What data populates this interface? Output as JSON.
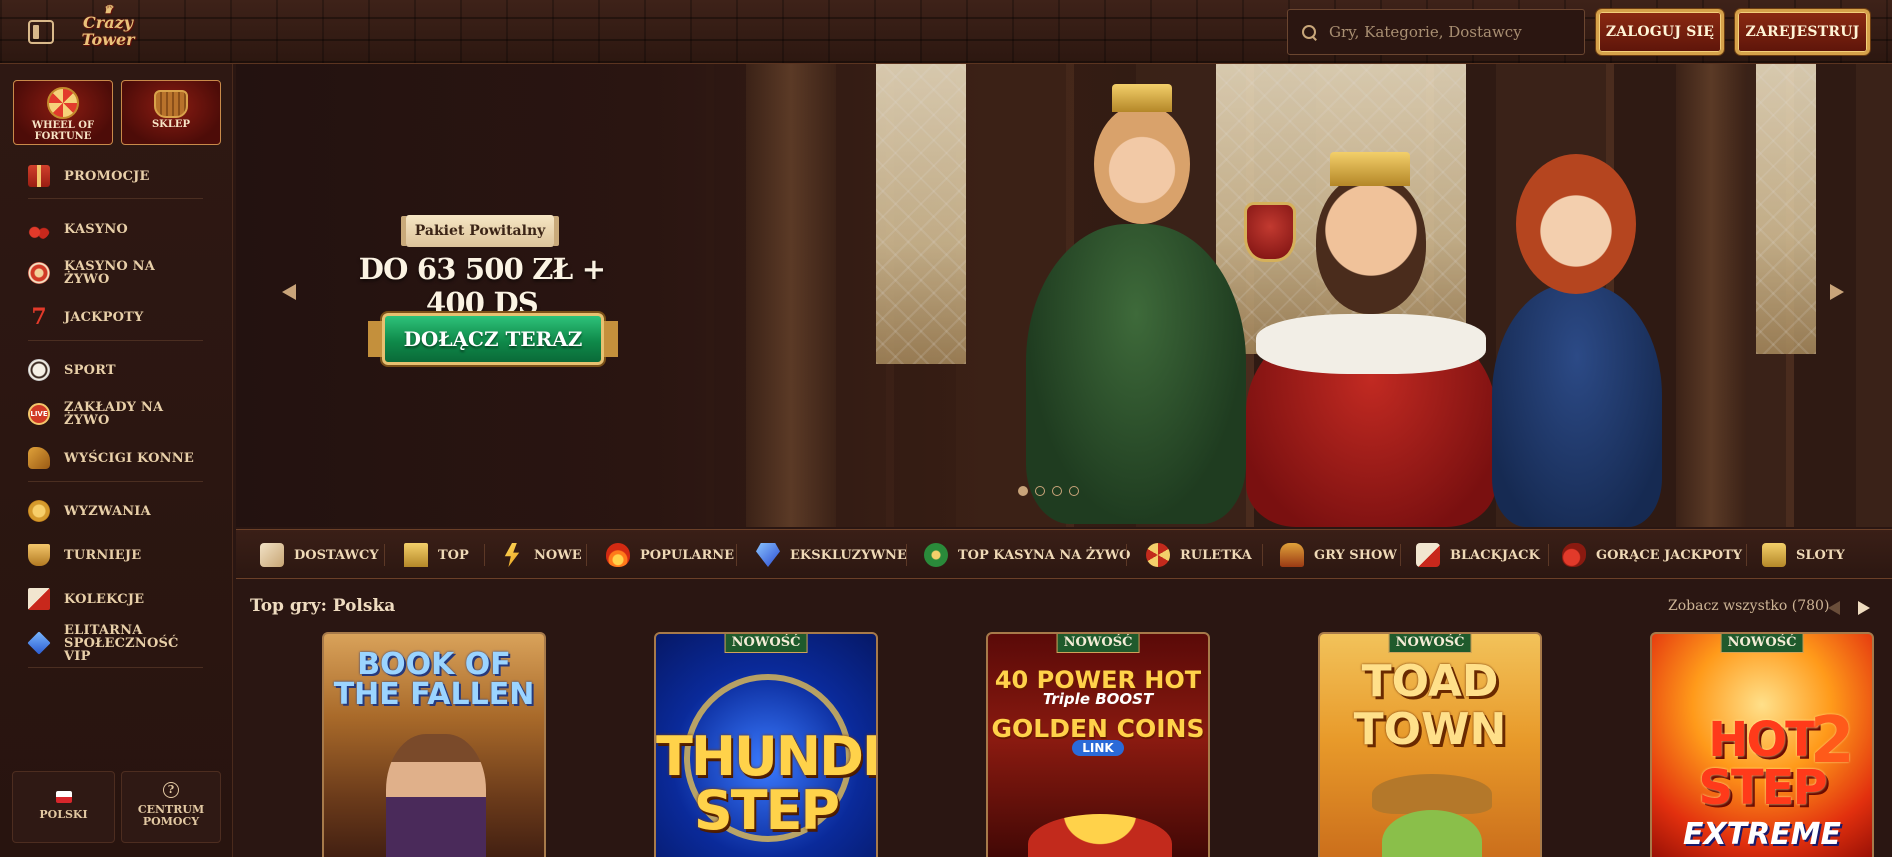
{
  "header": {
    "logo_line1": "Crazy",
    "logo_line2": "Tower",
    "search_placeholder": "Gry, Kategorie, Dostawcy",
    "login_label": "ZALOGUJ SIĘ",
    "register_label": "ZAREJESTRUJ"
  },
  "sidebar": {
    "tiles": [
      {
        "label": "WHEEL OF FORTUNE",
        "icon": "wheel-icon"
      },
      {
        "label": "SKLEP",
        "icon": "basket-icon"
      }
    ],
    "items": [
      {
        "label": "PROMOCJE",
        "icon": "gift-icon"
      },
      {
        "label": "KASYNO",
        "icon": "cherry-icon"
      },
      {
        "label": "KASYNO NA ŻYWO",
        "icon": "chip-icon"
      },
      {
        "label": "JACKPOTY",
        "icon": "seven-icon"
      },
      {
        "label": "SPORT",
        "icon": "soccer-ball-icon"
      },
      {
        "label": "ZAKŁADY NA ŻYWO",
        "icon": "live-icon"
      },
      {
        "label": "WYŚCIGI KONNE",
        "icon": "horse-icon"
      },
      {
        "label": "WYZWANIA",
        "icon": "medal-icon"
      },
      {
        "label": "TURNIEJE",
        "icon": "trophy-icon"
      },
      {
        "label": "KOLEKCJE",
        "icon": "cards-icon"
      },
      {
        "label": "ELITARNA SPOŁECZNOŚĆ VIP",
        "icon": "diamond-icon"
      }
    ],
    "language_label": "POLSKI",
    "help_label": "CENTRUM POMOCY",
    "help_glyph": "?"
  },
  "hero": {
    "ribbon": "Pakiet Powitalny",
    "headline": "DO 63 500 ZŁ + 400 DS",
    "cta_label": "DOŁĄCZ TERAZ",
    "slides_total": 4,
    "active_slide": 1
  },
  "categories": [
    {
      "label": "DOSTAWCY",
      "icon": "scroll-icon"
    },
    {
      "label": "TOP",
      "icon": "crown-icon"
    },
    {
      "label": "NOWE",
      "icon": "lightning-icon"
    },
    {
      "label": "POPULARNE",
      "icon": "fire-icon"
    },
    {
      "label": "EKSKLUZYWNE",
      "icon": "diamond-icon"
    },
    {
      "label": "TOP KASYNA NA ŻYWO",
      "icon": "live-chip-icon"
    },
    {
      "label": "RULETKA",
      "icon": "roulette-icon"
    },
    {
      "label": "GRY SHOW",
      "icon": "show-icon"
    },
    {
      "label": "BLACKJACK",
      "icon": "cards-icon"
    },
    {
      "label": "GORĄCE JACKPOTY",
      "icon": "hot-pepper-icon"
    },
    {
      "label": "SLOTY",
      "icon": "slot-icon"
    }
  ],
  "top_games": {
    "title": "Top gry: Polska",
    "see_all": "Zobacz wszystko (780)",
    "new_badge": "NOWOŚĆ",
    "games": [
      {
        "title": "BOOK OF THE FALLEN",
        "is_new": false
      },
      {
        "title": "THUNDER STEP",
        "is_new": true
      },
      {
        "title_a": "40 POWER HOT",
        "title_b": "Triple BOOST",
        "title_c": "GOLDEN COINS",
        "title_d": "LINK",
        "is_new": true
      },
      {
        "title": "TOAD TOWN",
        "is_new": true
      },
      {
        "title_a": "HOT STEP",
        "title_num": "2",
        "title_b": "EXTREME",
        "is_new": true
      }
    ]
  }
}
